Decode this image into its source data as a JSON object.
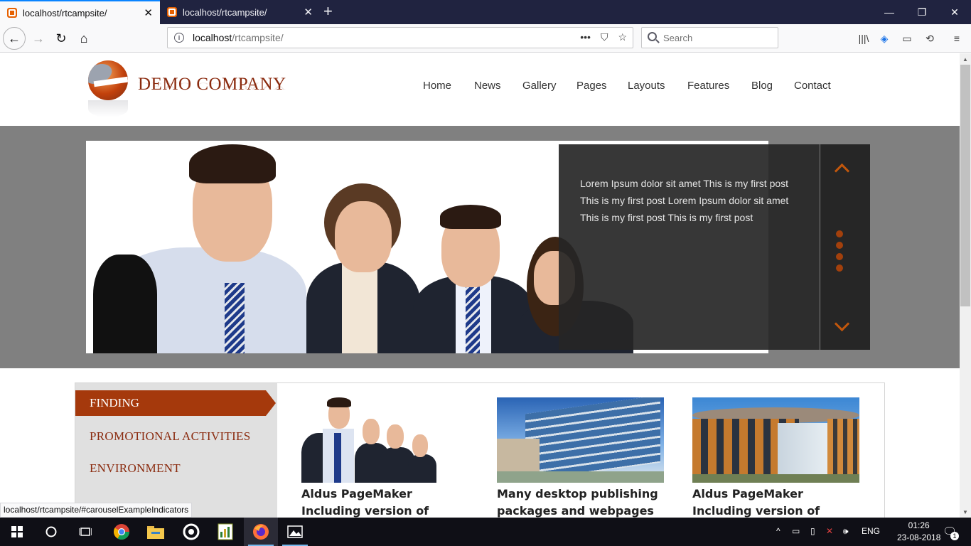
{
  "browser": {
    "tabs": [
      {
        "label": "localhost/rtcampsite/",
        "active": true
      },
      {
        "label": "localhost/rtcampsite/",
        "active": false
      }
    ],
    "url_host": "localhost",
    "url_path": "/rtcampsite/",
    "search_placeholder": "Search",
    "status_url": "localhost/rtcampsite/#carouselExampleIndicators"
  },
  "site": {
    "brand": "DEMO COMPANY",
    "nav": [
      "Home",
      "News",
      "Gallery",
      "Pages",
      "Layouts",
      "Features",
      "Blog",
      "Contact"
    ],
    "carousel": {
      "caption": "Lorem Ipsum dolor sit amet This is my first post This is my first post Lorem Ipsum dolor sit amet This is my first post This is my first post",
      "indicator_count": 4
    },
    "sidebar": {
      "items": [
        "FINDING",
        "PROMOTIONAL ACTIVITIES",
        "ENVIRONMENT"
      ],
      "active": "FINDING"
    },
    "cards": [
      {
        "title": "Aldus PageMaker Including version of Lorem Ipsom",
        "image": "business-team-photo"
      },
      {
        "title": "Many desktop publishing packages and webpages",
        "image": "glass-office-building-photo"
      },
      {
        "title": "Aldus PageMaker Including version of Lorem Ipsom",
        "image": "modern-office-building-photo"
      }
    ]
  },
  "taskbar": {
    "language": "ENG",
    "time": "01:26",
    "date": "23-08-2018",
    "notifications": "1"
  },
  "colors": {
    "accent": "#a5390c",
    "brand_text": "#8a2a0e",
    "hero_band": "#808080"
  }
}
